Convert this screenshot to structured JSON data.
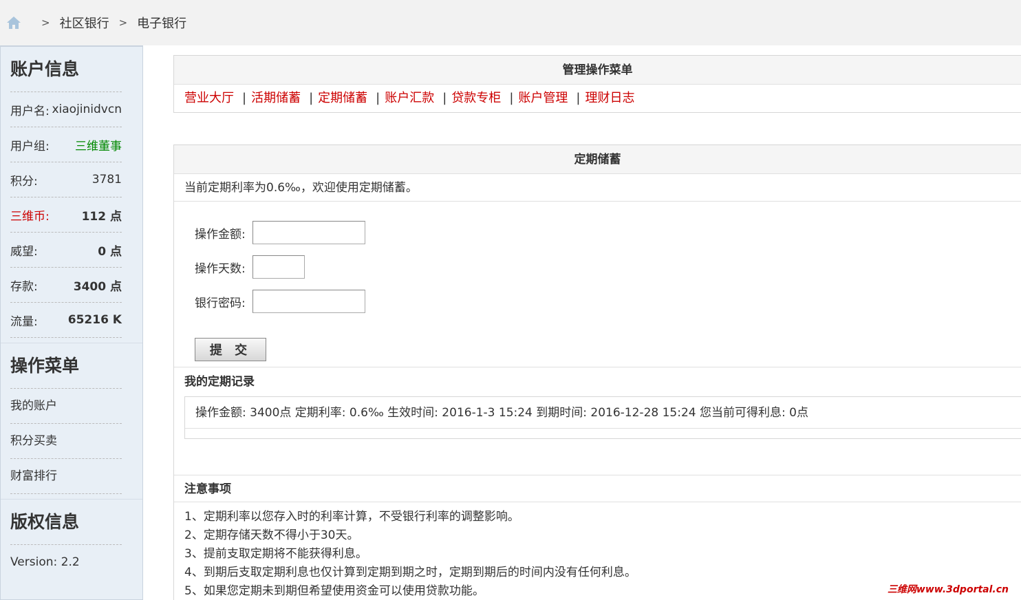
{
  "breadcrumb": {
    "sep": ">",
    "items": [
      "社区银行",
      "电子银行"
    ]
  },
  "sidebar": {
    "account_title": "账户信息",
    "rows": [
      {
        "label": "用户名:",
        "value": "xiaojinidvcn"
      },
      {
        "label": "用户组:",
        "value": "三维董事"
      },
      {
        "label": "积分:",
        "value": "3781"
      },
      {
        "label": "三维币:",
        "value": "112 点"
      },
      {
        "label": "威望:",
        "value": "0 点"
      },
      {
        "label": "存款:",
        "value": "3400 点"
      },
      {
        "label": "流量:",
        "value": "65216 K"
      }
    ],
    "menu_title": "操作菜单",
    "menu_items": [
      "我的账户",
      "积分买卖",
      "财富排行"
    ],
    "copyright_title": "版权信息",
    "version": "Version: 2.2"
  },
  "main": {
    "menu_head": "管理操作菜单",
    "menu_links": [
      "营业大厅",
      "活期储蓄",
      "定期储蓄",
      "账户汇款",
      "贷款专柜",
      "账户管理",
      "理财日志"
    ],
    "menu_sep": "|",
    "deposit_head": "定期储蓄",
    "rate_info": "当前定期利率为0.6‰，欢迎使用定期储蓄。",
    "form": {
      "amount_label": "操作金额:",
      "days_label": "操作天数:",
      "password_label": "银行密码:",
      "amount_value": "",
      "days_value": "",
      "password_value": "",
      "submit_label": "提 交"
    },
    "records_title": "我的定期记录",
    "record_line": "操作金额: 3400点   定期利率: 0.6‰   生效时间: 2016-1-3 15:24   到期时间: 2016-12-28 15:24   您当前可得利息: 0点",
    "notice_title": "注意事项",
    "notices": [
      "1、定期利率以您存入时的利率计算，不受银行利率的调整影响。",
      "2、定期存储天数不得小于30天。",
      "3、提前支取定期将不能获得利息。",
      "4、到期后支取定期利息也仅计算到定期到期之时，定期到期后的时间内没有任何利息。",
      "5、如果您定期未到期但希望使用资金可以使用贷款功能。"
    ]
  },
  "watermark": "三维网www.3dportal.cn"
}
